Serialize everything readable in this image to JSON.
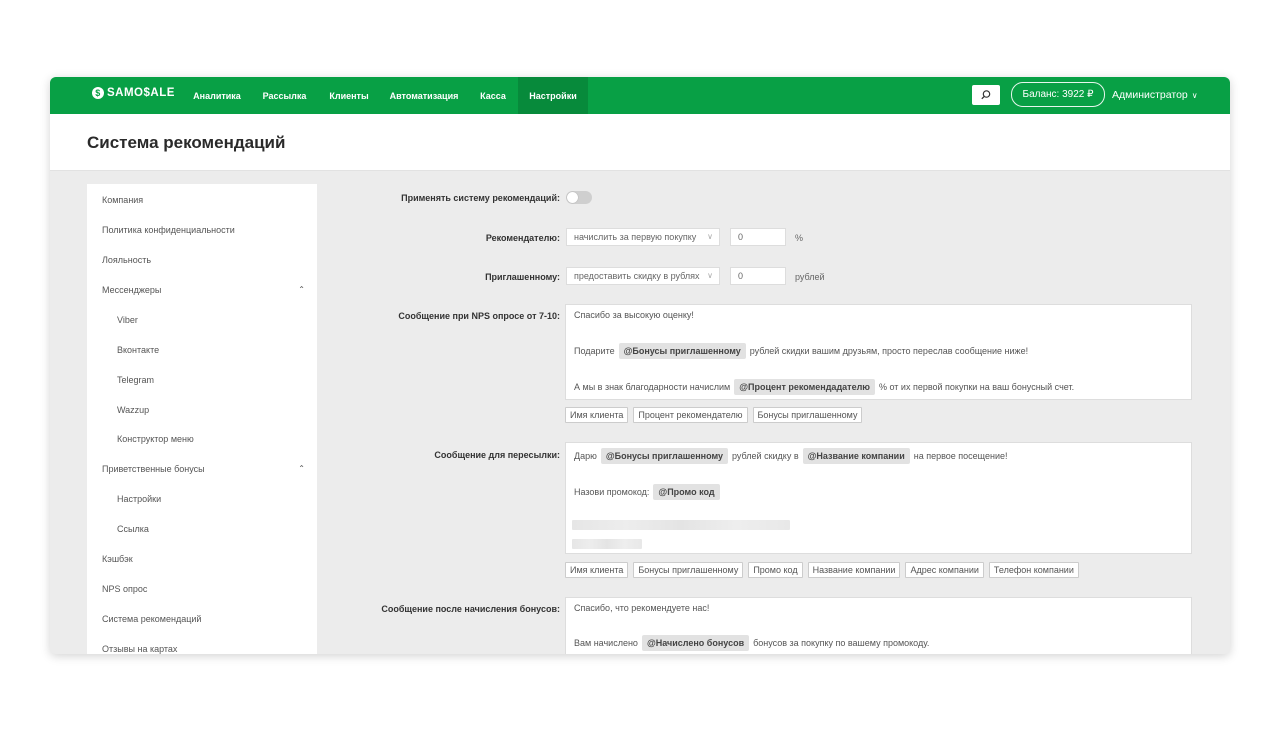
{
  "brand": {
    "logo_text": "SAMO$ALE",
    "color": "#08a045"
  },
  "nav": [
    "Аналитика",
    "Рассылка",
    "Клиенты",
    "Автоматизация",
    "Касса",
    "Настройки"
  ],
  "nav_active": "Настройки",
  "header": {
    "balance": "Баланс: 3922 ₽",
    "user": "Администратор",
    "search_icon": "search-icon"
  },
  "page_title": "Система рекомендаций",
  "sidebar": {
    "items": [
      "Компания",
      "Политика конфиденциальности",
      "Лояльность",
      "Мессенджеры",
      "Viber",
      "Вконтакте",
      "Telegram",
      "Wazzup",
      "Конструктор меню",
      "Приветственные бонусы",
      "Настройки",
      "Ссылка",
      "Кэшбэк",
      "NPS опрос",
      "Система рекомендаций",
      "Отзывы на картах"
    ]
  },
  "form": {
    "apply": {
      "label": "Применять систему рекомендаций:",
      "enabled": false
    },
    "referrer": {
      "label": "Рекомендателю:",
      "option": "начислить за первую покупку",
      "value": "0",
      "unit": "%"
    },
    "invited": {
      "label": "Приглашенному:",
      "option": "предоставить скидку в рублях",
      "value": "0",
      "unit": "рублей"
    },
    "nps": {
      "label": "Сообщение при NPS опросе от 7-10:",
      "line1": "Спасибо за высокую оценку!",
      "line2_a": "Подарите",
      "line2_tag": "@Бонусы приглашенному",
      "line2_b": "рублей скидки вашим друзьям, просто переслав сообщение ниже!",
      "line3_a": "А мы в знак благодарности начислим",
      "line3_tag": "@Процент рекомендадателю",
      "line3_b": "% от их первой покупки на ваш бонусный счет.",
      "chips": [
        "Имя клиента",
        "Процент рекомендателю",
        "Бонусы приглашенному"
      ]
    },
    "forward": {
      "label": "Сообщение для пересылки:",
      "line1_a": "Дарю",
      "line1_tag1": "@Бонусы приглашенному",
      "line1_b": "рублей скидку в",
      "line1_tag2": "@Название компании",
      "line1_c": "на первое посещение!",
      "line2_a": "Назови промокод:",
      "line2_tag": "@Промо код",
      "chips": [
        "Имя клиента",
        "Бонусы приглашенному",
        "Промо код",
        "Название компании",
        "Адрес компании",
        "Телефон компании"
      ]
    },
    "after_bonus": {
      "label": "Сообщение после начисления бонусов:",
      "line1": "Спасибо, что рекомендуете нас!",
      "line2_a": "Вам начислено",
      "line2_tag": "@Начислено бонусов",
      "line2_b": "бонусов за покупку по вашему промокоду."
    }
  }
}
